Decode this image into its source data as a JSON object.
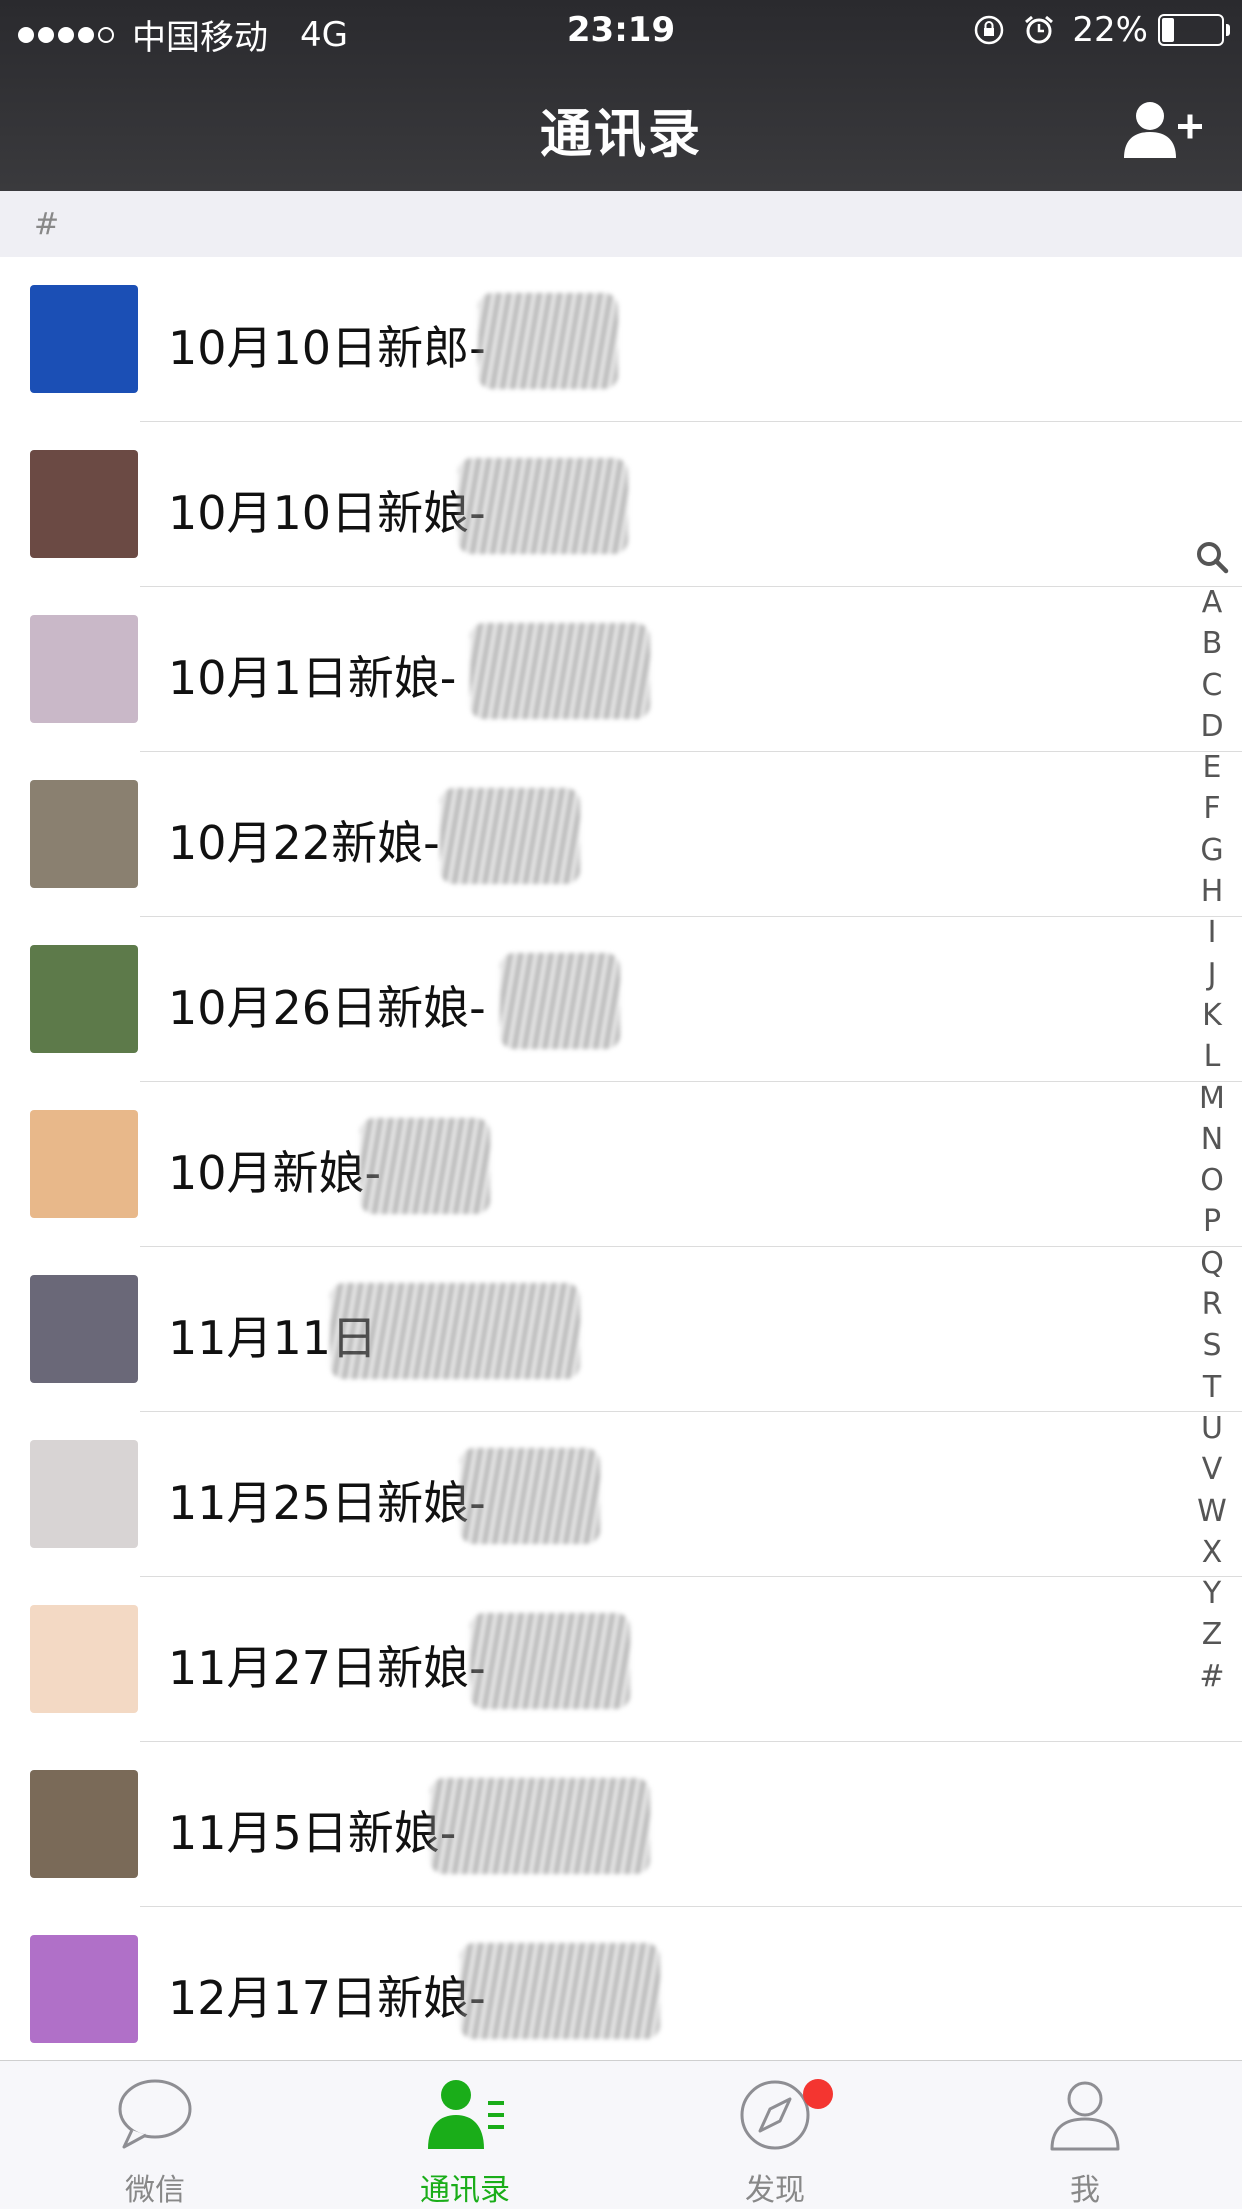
{
  "status_bar": {
    "carrier": "中国移动",
    "network": "4G",
    "time": "23:19",
    "battery": "22%",
    "battery_level": 0.22
  },
  "nav": {
    "title": "通讯录",
    "add_icon": "add-contact-icon"
  },
  "section": {
    "header": "#"
  },
  "contacts": [
    {
      "name": "10月10日新郎-",
      "avatar_color": "#1b4fb5"
    },
    {
      "name": "10月10日新娘-",
      "avatar_color": "#6b4a44"
    },
    {
      "name": "10月1日新娘-",
      "avatar_color": "#c9b8c8"
    },
    {
      "name": "10月22新娘-",
      "avatar_color": "#8a8070"
    },
    {
      "name": "10月26日新娘-",
      "avatar_color": "#5d7a4a"
    },
    {
      "name": "10月新娘-",
      "avatar_color": "#e8b88a"
    },
    {
      "name": "11月11日",
      "avatar_color": "#6a6878"
    },
    {
      "name": "11月25日新娘-",
      "avatar_color": "#d8d4d4"
    },
    {
      "name": "11月27日新娘-",
      "avatar_color": "#f3d9c4"
    },
    {
      "name": "11月5日新娘-",
      "avatar_color": "#7a6a58"
    },
    {
      "name": "12月17日新娘-",
      "avatar_color": "#b070c8"
    }
  ],
  "index": [
    "A",
    "B",
    "C",
    "D",
    "E",
    "F",
    "G",
    "H",
    "I",
    "J",
    "K",
    "L",
    "M",
    "N",
    "O",
    "P",
    "Q",
    "R",
    "S",
    "T",
    "U",
    "V",
    "W",
    "X",
    "Y",
    "Z",
    "#"
  ],
  "tabs": [
    {
      "label": "微信",
      "icon": "chat-bubble-icon",
      "active": false
    },
    {
      "label": "通讯录",
      "icon": "contacts-icon",
      "active": true
    },
    {
      "label": "发现",
      "icon": "compass-icon",
      "active": false,
      "badge": true
    },
    {
      "label": "我",
      "icon": "person-icon",
      "active": false
    }
  ],
  "colors": {
    "accent_green": "#1aad19",
    "badge_red": "#f43530",
    "nav_background": "#2e2e31"
  }
}
